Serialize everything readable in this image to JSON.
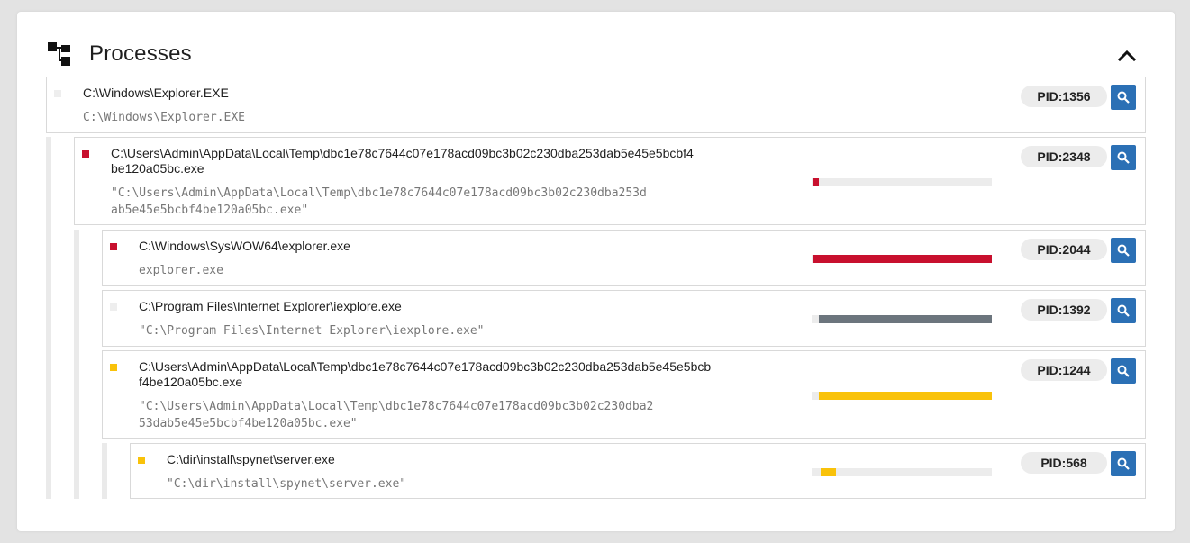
{
  "section": {
    "title": "Processes",
    "icon": "process-tree-icon",
    "collapse_icon": "chevron-up-icon"
  },
  "processes": [
    {
      "path": "C:\\Windows\\Explorer.EXE",
      "cmd": "C:\\Windows\\Explorer.EXE",
      "pid": "PID:1356",
      "status_color": "#eeeeee",
      "usage": null
    },
    {
      "path": "C:\\Users\\Admin\\AppData\\Local\\Temp\\dbc1e78c7644c07e178acd09bc3b02c230dba253dab5e45e5bcbf4\nbe120a05bc.exe",
      "cmd": "\"C:\\Users\\Admin\\AppData\\Local\\Temp\\dbc1e78c7644c07e178acd09bc3b02c230dba253d\nab5e45e5bcbf4be120a05bc.exe\"",
      "pid": "PID:2348",
      "status_color": "#c8102e",
      "usage": 0.04
    },
    {
      "path": "C:\\Windows\\SysWOW64\\explorer.exe",
      "cmd": "explorer.exe",
      "pid": "PID:2044",
      "status_color": "#c8102e",
      "usage": 0.99
    },
    {
      "path": "C:\\Program Files\\Internet Explorer\\iexplore.exe",
      "cmd": "\"C:\\Program Files\\Internet Explorer\\iexplore.exe\"",
      "pid": "PID:1392",
      "status_color": "#eeeeee",
      "usage": 0.96
    },
    {
      "path": "C:\\Users\\Admin\\AppData\\Local\\Temp\\dbc1e78c7644c07e178acd09bc3b02c230dba253dab5e45e5bcb\nf4be120a05bc.exe",
      "cmd": "\"C:\\Users\\Admin\\AppData\\Local\\Temp\\dbc1e78c7644c07e178acd09bc3b02c230dba2\n53dab5e45e5bcbf4be120a05bc.exe\"",
      "pid": "PID:1244",
      "status_color": "#f9c20a",
      "usage": 0.96
    },
    {
      "path": "C:\\dir\\install\\spynet\\server.exe",
      "cmd": "\"C:\\dir\\install\\spynet\\server.exe\"",
      "pid": "PID:568",
      "status_color": "#f9c20a",
      "usage": 0.09
    }
  ],
  "colors": {
    "red": "#c8102e",
    "gray": "#6c757d",
    "yellow": "#f9c20a",
    "accent": "#2b70b5"
  }
}
